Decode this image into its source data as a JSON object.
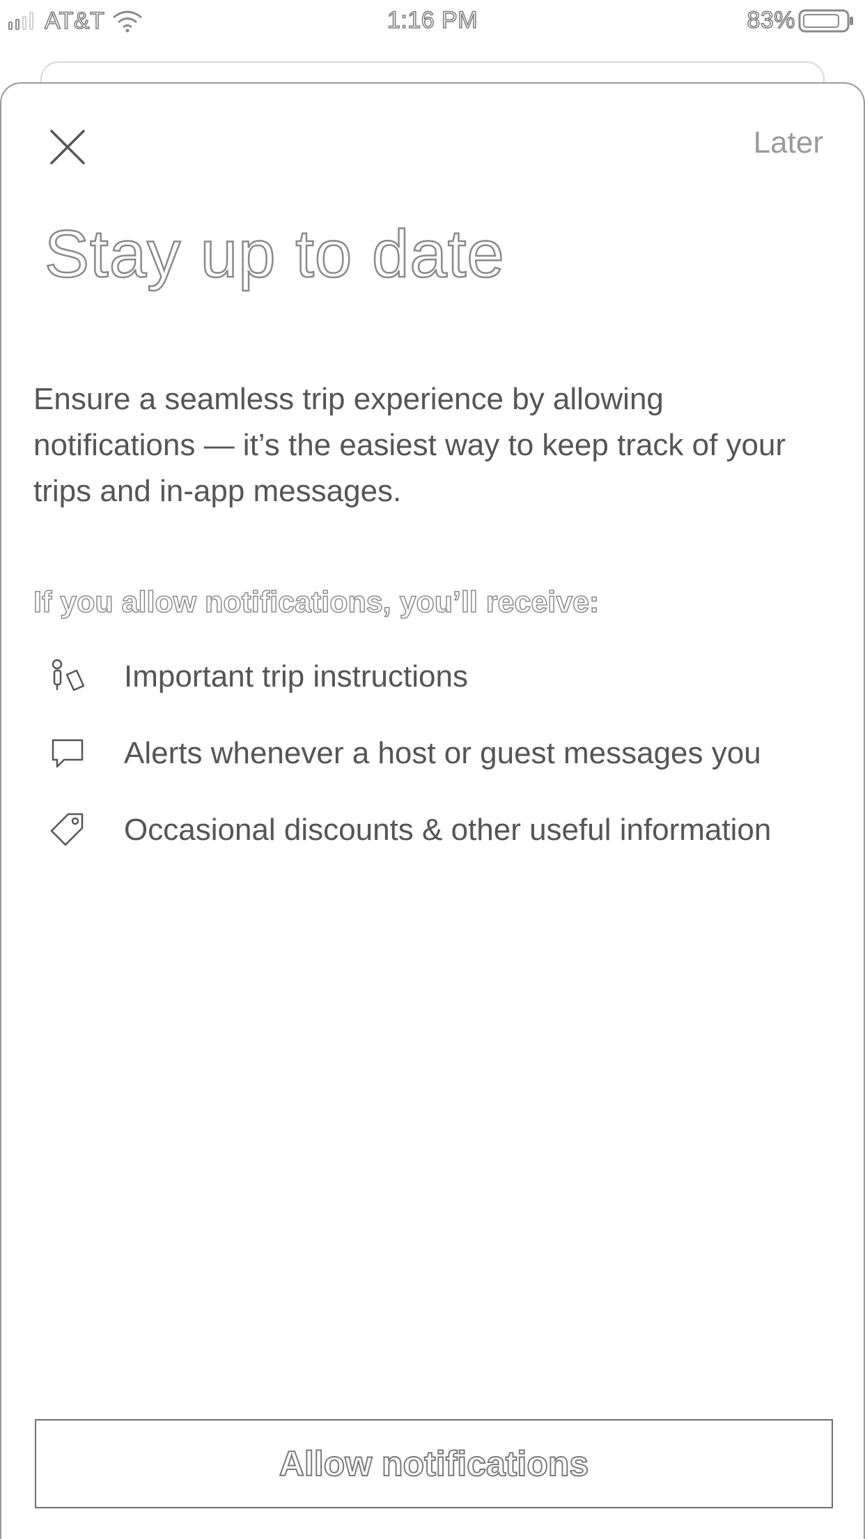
{
  "status_bar": {
    "carrier": "AT&T",
    "time": "1:16 PM",
    "battery_percent": "83%",
    "icons": [
      "signal-icon",
      "wifi-icon",
      "battery-icon"
    ]
  },
  "sheet": {
    "close_icon": "close-icon",
    "later_label": "Later",
    "title": "Stay up to date",
    "description": "Ensure a seamless trip experience by allowing notifications — it’s the easiest way to keep track of your trips and in-app messages.",
    "benefits_heading": "If you allow notifications, you’ll receive:",
    "benefits": [
      {
        "icon": "trip-instructions-icon",
        "text": "Important trip instructions"
      },
      {
        "icon": "message-bubble-icon",
        "text": "Alerts whenever a host or guest messages you"
      },
      {
        "icon": "tag-icon",
        "text": "Occasional discounts & other useful information"
      }
    ],
    "allow_button_label": "Allow notifications"
  },
  "colors": {
    "background": "#ffffff",
    "text": "#555555",
    "muted": "#9a9a9a",
    "border": "#6f6f6f"
  }
}
